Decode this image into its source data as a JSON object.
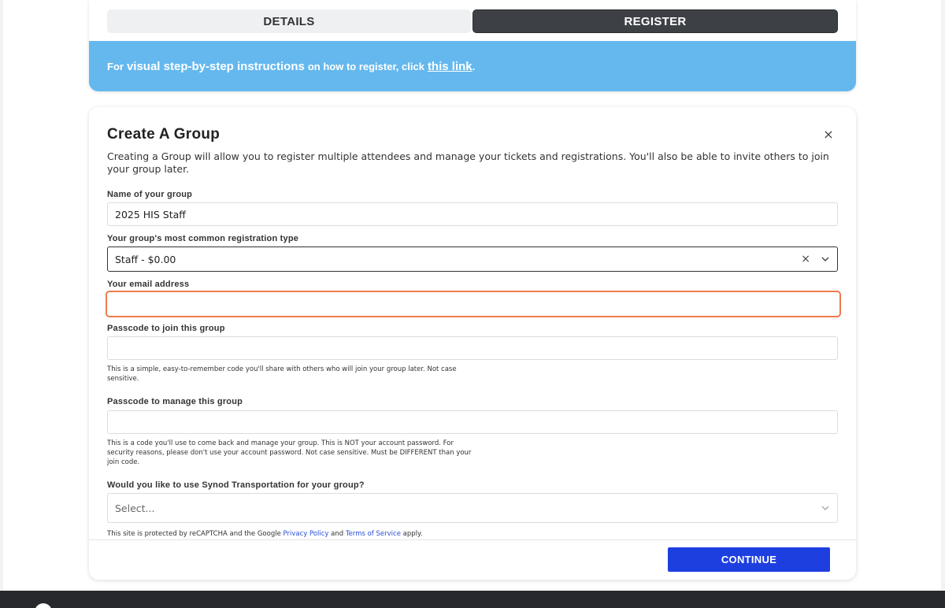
{
  "tabs": [
    {
      "label": "DETAILS"
    },
    {
      "label": "REGISTER"
    }
  ],
  "banner": {
    "prefix": "For",
    "strong": "visual step-by-step instructions",
    "middle": "on how to register, click",
    "link": "this link",
    "suffix": "."
  },
  "modal": {
    "title": "Create A Group",
    "close_symbol": "×",
    "description": "Creating a Group will allow you to register multiple attendees and manage your tickets and registrations. You'll also be able to invite others to join your group later.",
    "fields": {
      "group_name": {
        "label": "Name of your group",
        "value": "2025 HIS Staff"
      },
      "registration_type": {
        "label": "Your group's most common registration type",
        "value": "Staff - $0.00"
      },
      "email": {
        "label": "Your email address",
        "value": ""
      },
      "join_passcode": {
        "label": "Passcode to join this group",
        "value": "",
        "hint": "This is a simple, easy-to-remember code you'll share with others who will join your group later. Not case sensitive."
      },
      "manage_passcode": {
        "label": "Passcode to manage this group",
        "value": "",
        "hint": "This is a code you'll use to come back and manage your group. This is NOT your account password. For security reasons, please don't use your account password. Not case sensitive. Must be DIFFERENT than your join code."
      },
      "transportation": {
        "label": "Would you like to use Synod Transportation for your group?",
        "placeholder": "Select..."
      }
    },
    "recaptcha": {
      "prefix": "This site is protected by reCAPTCHA and the Google",
      "privacy": "Privacy Policy",
      "and": "and",
      "terms": "Terms of Service",
      "suffix": "apply."
    },
    "continue_label": "CONTINUE"
  },
  "icons": {
    "close": "close-icon",
    "clear": "clear-icon",
    "chevron": "chevron-down-icon"
  },
  "colors": {
    "banner": "#64b8ee",
    "active_tab": "#3d4146",
    "focus_border": "#f07a4a",
    "primary_button": "#1e3fe0",
    "link": "#2b4fd6"
  }
}
